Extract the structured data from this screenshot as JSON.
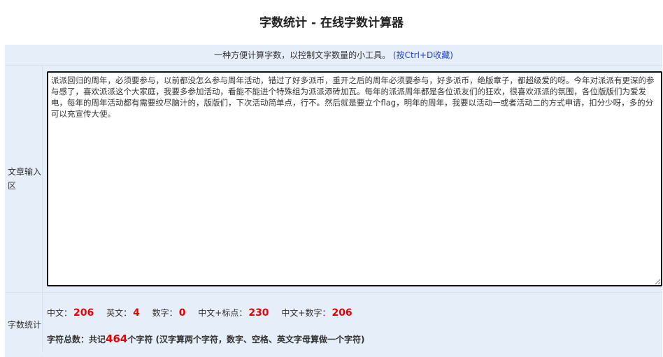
{
  "page": {
    "title": "字数统计 - 在线字数计算器"
  },
  "tip": {
    "text": "一种方便计算字数，以控制文字数量的小工具。",
    "bookmark_link": "(按Ctrl+D收藏)"
  },
  "input_section": {
    "label": "文章输入区",
    "content": "派派回归的周年，必须要参与，以前都没怎么参与周年活动，错过了好多派币，重开之后的周年必须要参与，好多派币，绝版章子，都超级爱的呀。今年对派派有更深的参与感了，喜欢派派这个大家庭，我要多参加活动，看能不能进个特殊组为派派添砖加瓦。每年的派派周年都是各位派友们的狂欢，很喜欢派派的氛围，各位版版们为爱发电，每年的周年活动都有需要绞尽脑汁的，版版们，下次活动简单点，行不。然后就是要立个flag，明年的周年，我要以活动一或者活动二的方式申请，扣分少呀，多的分可以充宣传大使。"
  },
  "stats": {
    "label": "字数统计",
    "items": [
      {
        "label": "中文：",
        "value": "206"
      },
      {
        "label": "英文：",
        "value": "4"
      },
      {
        "label": "数字：",
        "value": "0"
      },
      {
        "label": "中文+标点：",
        "value": "230"
      },
      {
        "label": "中文+数字：",
        "value": "206"
      }
    ],
    "total_prefix": "字符总数：共记",
    "total_value": "464",
    "total_suffix": "个字符 (汉字算两个字符，数字、空格、英文字母算做一个字符)"
  },
  "colors": {
    "panel_bg": "#e5eef9",
    "highlight_number": "#e60000",
    "link": "#2244cc"
  }
}
